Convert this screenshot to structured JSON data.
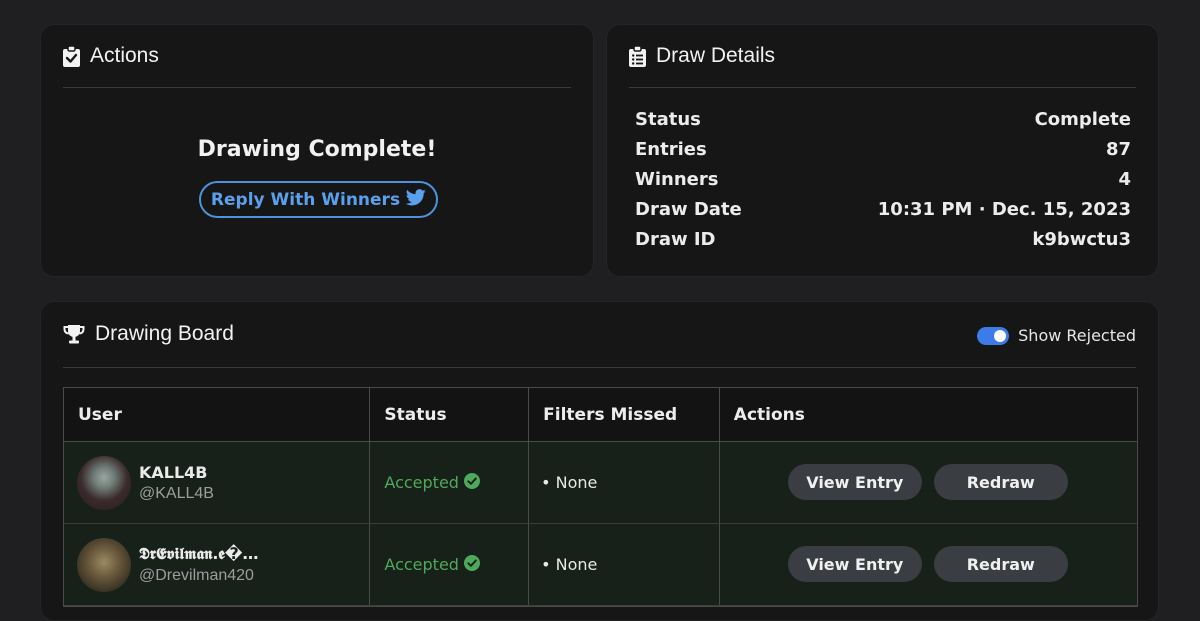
{
  "actions_card": {
    "title": "Actions",
    "message": "Drawing Complete!",
    "reply_button": "Reply With Winners"
  },
  "details_card": {
    "title": "Draw Details",
    "rows": [
      {
        "label": "Status",
        "value": "Complete"
      },
      {
        "label": "Entries",
        "value": "87"
      },
      {
        "label": "Winners",
        "value": "4"
      },
      {
        "label": "Draw Date",
        "value": "10:31 PM · Dec. 15, 2023"
      },
      {
        "label": "Draw ID",
        "value": "k9bwctu3"
      }
    ]
  },
  "board": {
    "title": "Drawing Board",
    "toggle_label": "Show Rejected",
    "toggle_on": true,
    "columns": [
      "User",
      "Status",
      "Filters Missed",
      "Actions"
    ],
    "rows": [
      {
        "name": "KALL4B",
        "handle": "@KALL4B",
        "status": "Accepted",
        "filters": "• None",
        "view": "View Entry",
        "redraw": "Redraw"
      },
      {
        "name": "𝕯𝖗𝕰𝖛𝖎𝖑𝖒𝖆𝖓.𝖊�…",
        "handle": "@Drevilman420",
        "status": "Accepted",
        "filters": "• None",
        "view": "View Entry",
        "redraw": "Redraw"
      }
    ]
  },
  "colors": {
    "accent_blue": "#4d92dd",
    "accepted_green": "#4fa95a",
    "toggle_blue": "#3a7de8"
  }
}
